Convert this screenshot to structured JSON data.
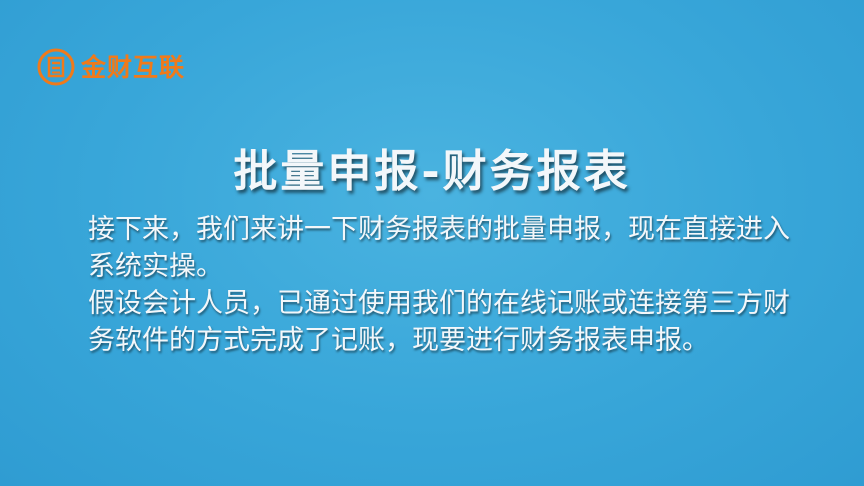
{
  "logo": {
    "text": "金财互联",
    "icon": "logo-emblem-icon",
    "color": "#f07a1a"
  },
  "title": "批量申报-财务报表",
  "paragraphs": [
    "接下来，我们来讲一下财务报表的批量申报，现在直接进入系统实操。",
    "假设会计人员，已通过使用我们的在线记账或连接第三方财务软件的方式完成了记账，现要进行财务报表申报。"
  ],
  "colors": {
    "background": "#38a6d9",
    "text": "#f3f7fa"
  }
}
